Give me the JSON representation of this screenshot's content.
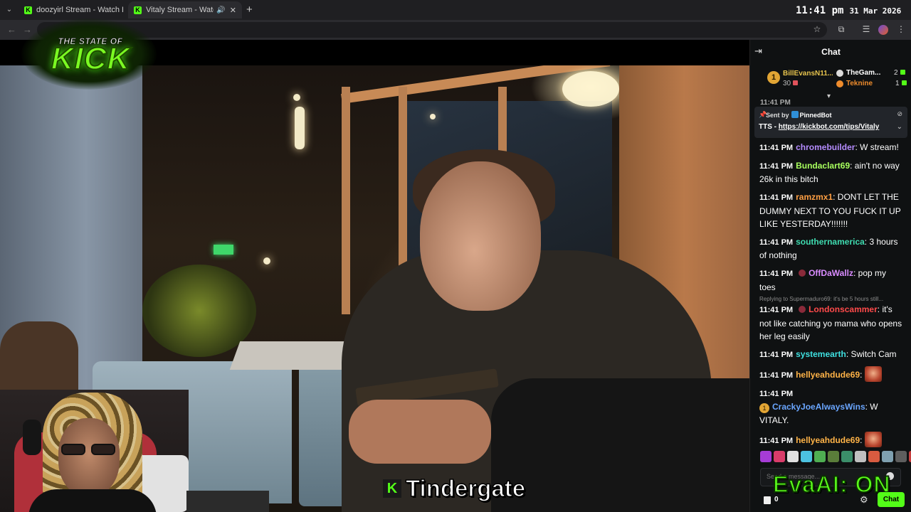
{
  "browser": {
    "tabs": [
      {
        "title": "doozyirl Stream - Watch Live on",
        "active": false
      },
      {
        "title": "Vitaly Stream - Watch Live o",
        "active": true
      }
    ],
    "clock_time": "11:41 pm",
    "clock_date": "31 Mar 2026"
  },
  "overlay": {
    "logo_top": "THE STATE OF",
    "logo_main": "KICK",
    "caption": "Tindergate",
    "eva_ai": "EvaAI: ON"
  },
  "chat": {
    "header": "Chat",
    "gifters": [
      {
        "rank": "1",
        "name": "BillEvansN11...",
        "count": "30"
      },
      {
        "name": "TheGam...",
        "count": "2"
      },
      {
        "name": "Teknine",
        "count": "1"
      }
    ],
    "cutoff_text": "11:41 PM",
    "pinned": {
      "sent_by_label": "Sent by",
      "bot": "PinnedBot",
      "prefix": "TTS -",
      "link": "https://kickbot.com/tips/Vitaly"
    },
    "messages": [
      {
        "time": "11:41 PM",
        "user": "chromebuilder",
        "color": "#b58cff",
        "text": "W stream!"
      },
      {
        "time": "11:41 PM",
        "user": "Bundaclart69",
        "color": "#a8ff5e",
        "text": "ain't no way 26k in this bitch"
      },
      {
        "time": "11:41 PM",
        "user": "ramzmx1",
        "color": "#ff9f43",
        "text": "DONT LET THE DUMMY NEXT TO YOU FUCK IT UP LIKE YESTERDAY!!!!!!!"
      },
      {
        "time": "11:41 PM",
        "user": "southernamerica",
        "color": "#3fdcb0",
        "text": "3 hours of nothing"
      },
      {
        "time": "11:41 PM",
        "user": "OffDaWallz",
        "color": "#d98cff",
        "text": "pop my toes",
        "badge": true
      },
      {
        "reply": "Replying to Supermaduro69: it's be 5 hours still...",
        "time": "11:41 PM",
        "user": "Londonscammer",
        "color": "#ff4a4a",
        "text": "it's not like catching yo mama who opens her leg easily",
        "badge": true
      },
      {
        "time": "11:41 PM",
        "user": "systemearth",
        "color": "#3fe0e0",
        "text": "Switch Cam"
      },
      {
        "time": "11:41 PM",
        "user": "hellyeahdude69",
        "color": "#ffb347",
        "text": "",
        "emote": true
      },
      {
        "time": "11:41 PM",
        "user": "CrackyJoeAlwaysWins",
        "color": "#6aa6ff",
        "text": "W VITALY.",
        "newline": true,
        "rank": "1"
      },
      {
        "time": "11:41 PM",
        "user": "hellyeahdude69",
        "color": "#ffb347",
        "text": "",
        "emote": true
      }
    ],
    "input_placeholder": "Send a message...",
    "foot_count": "0",
    "chat_button": "Chat"
  }
}
